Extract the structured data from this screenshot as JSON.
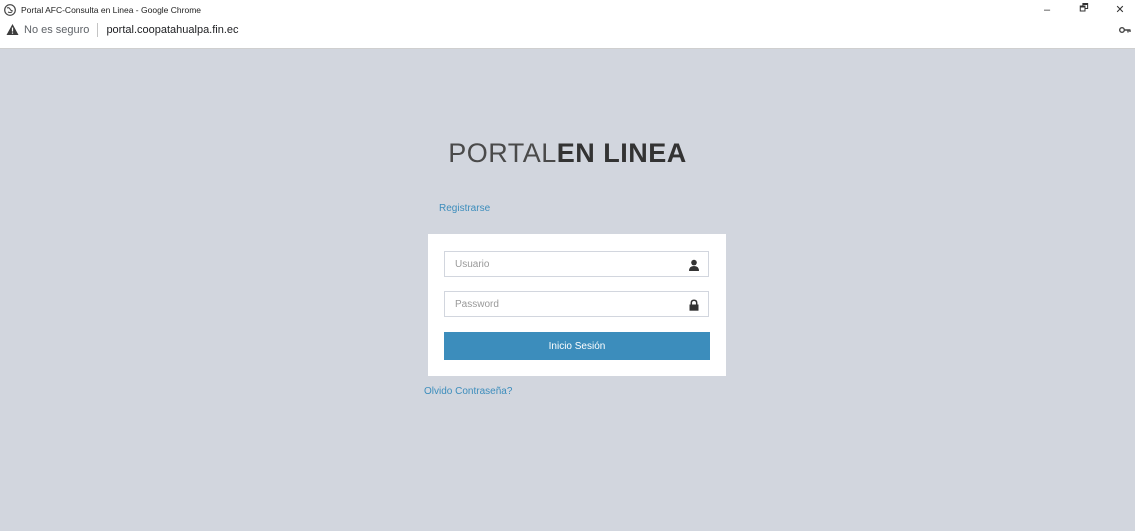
{
  "window": {
    "title": "Portal AFC-Consulta en Linea - Google Chrome",
    "controls": {
      "minimize": "–",
      "restore": "🗗",
      "close": "✕"
    }
  },
  "address_bar": {
    "security_label": "No es seguro",
    "url": "portal.coopatahualpa.fin.ec"
  },
  "logo": {
    "light": "PORTAL",
    "bold": "EN LINEA"
  },
  "links": {
    "register": "Registrarse",
    "forgot_password": "Olvido Contraseña?"
  },
  "login_form": {
    "username_placeholder": "Usuario",
    "username_value": "",
    "password_placeholder": "Password",
    "password_value": "",
    "submit_label": "Inicio Sesión"
  },
  "colors": {
    "background": "#d2d6de",
    "accent": "#3c8dbc",
    "panel": "#ffffff"
  },
  "icons": {
    "favicon": "globe-icon",
    "security": "warning-icon",
    "key": "key-icon",
    "user": "user-icon",
    "lock": "lock-icon"
  }
}
